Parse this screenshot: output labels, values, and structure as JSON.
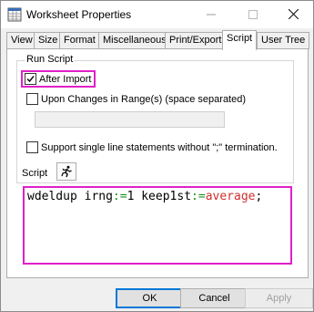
{
  "window": {
    "title": "Worksheet Properties"
  },
  "tabs": [
    {
      "label": "View"
    },
    {
      "label": "Size"
    },
    {
      "label": "Format"
    },
    {
      "label": "Miscellaneous"
    },
    {
      "label": "Print/Export"
    },
    {
      "label": "Script",
      "active": true
    },
    {
      "label": "User Tree"
    }
  ],
  "run_script": {
    "legend": "Run Script",
    "after_import": {
      "label": "After Import",
      "checked": true
    },
    "upon_changes": {
      "label": "Upon Changes in Range(s) (space separated)",
      "checked": false
    },
    "range_value": ""
  },
  "support_single_line": {
    "label": "Support single line statements without  \";\" termination.",
    "checked": false
  },
  "script": {
    "label": "Script",
    "code_parts": {
      "p1": "wdeldup irng",
      "p2": ":=",
      "p3": "1 keep1st",
      "p4": ":=",
      "p5": "average",
      "p6": ";"
    }
  },
  "buttons": {
    "ok": "OK",
    "cancel": "Cancel",
    "apply": "Apply"
  },
  "colors": {
    "highlight": "#e020c8",
    "operator": "#1a8f1a",
    "string": "#d03030"
  }
}
